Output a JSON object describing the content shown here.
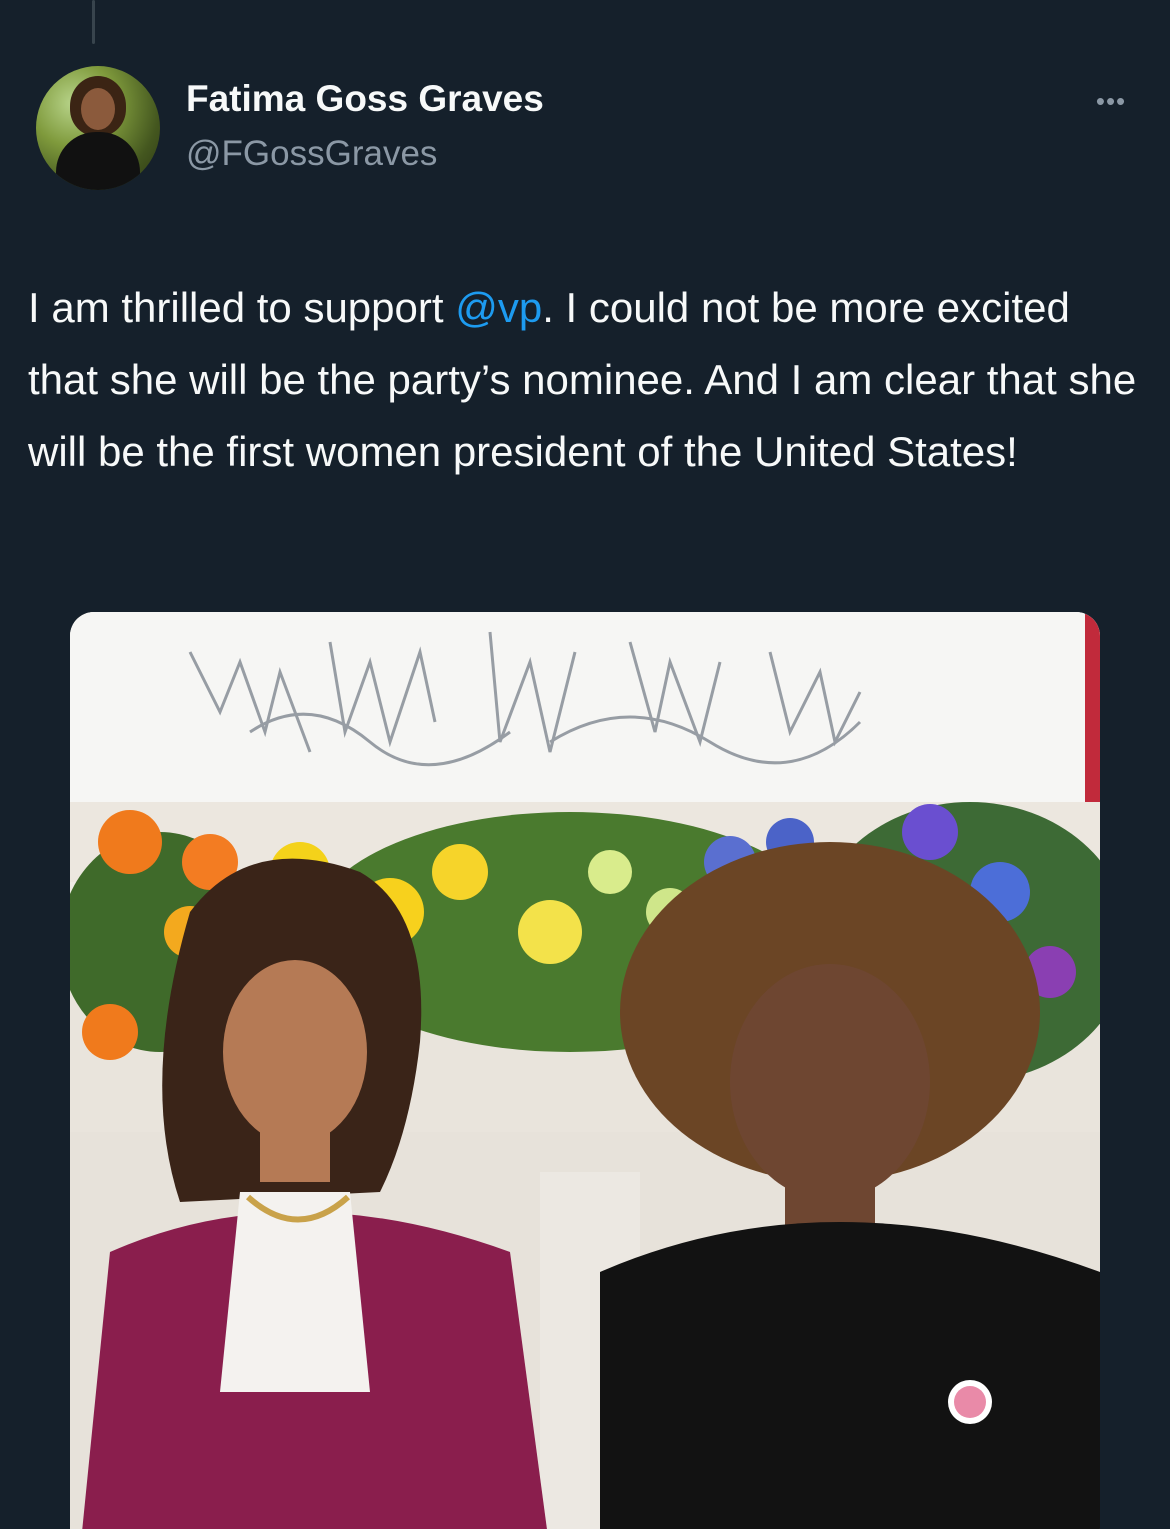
{
  "author": {
    "display_name": "Fatima Goss Graves",
    "handle": "@FGossGraves",
    "avatar_icon": "profile-photo"
  },
  "actions": {
    "more_icon": "more-horizontal-icon",
    "more_label": "•••"
  },
  "tweet": {
    "text_before_mention": "I am thrilled to support ",
    "mention": "@vp",
    "text_after_mention": ". I could not be more excited that she will be the party’s nominee. And I am clear that she will be the first women president of the United States!"
  },
  "media": {
    "type": "photo",
    "description_icon": "photo-two-women-flowers"
  },
  "colors": {
    "background": "#15202b",
    "text": "#f7f9f9",
    "secondary_text": "#8b98a5",
    "link": "#1d9bf0"
  }
}
